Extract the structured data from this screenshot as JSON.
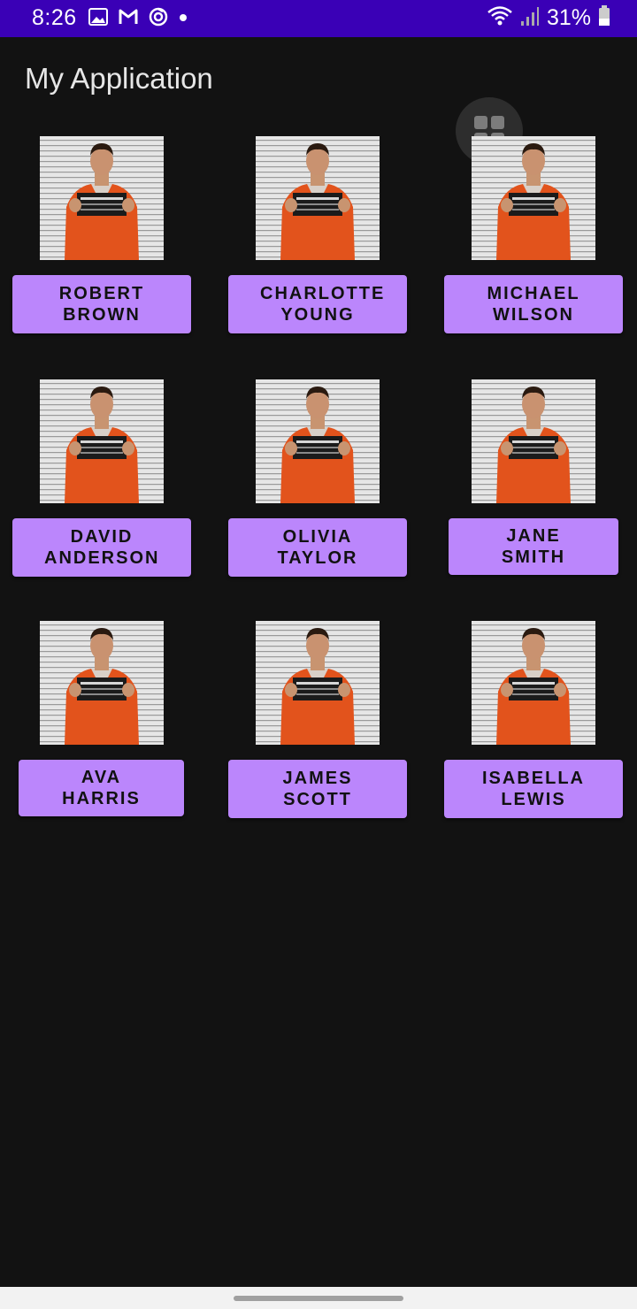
{
  "status_bar": {
    "time": "8:26",
    "battery": "31%",
    "left_icons": [
      "gallery-icon",
      "gmail-icon",
      "sync-icon",
      "dot-icon"
    ],
    "right_icons": [
      "wifi-icon",
      "signal-icon",
      "battery-icon"
    ]
  },
  "app": {
    "title": "My Application"
  },
  "floating_button": {
    "icon": "grid-icon"
  },
  "people": [
    {
      "name": "ROBERT BROWN"
    },
    {
      "name": "CHARLOTTE YOUNG"
    },
    {
      "name": "MICHAEL WILSON"
    },
    {
      "name": "DAVID ANDERSON"
    },
    {
      "name": "OLIVIA TAYLOR"
    },
    {
      "name": "JANE SMITH"
    },
    {
      "name": "AVA HARRIS"
    },
    {
      "name": "JAMES SCOTT"
    },
    {
      "name": "ISABELLA LEWIS"
    }
  ],
  "colors": {
    "status_bar": "#3a00b6",
    "background": "#121212",
    "button": "#bb86fc"
  }
}
